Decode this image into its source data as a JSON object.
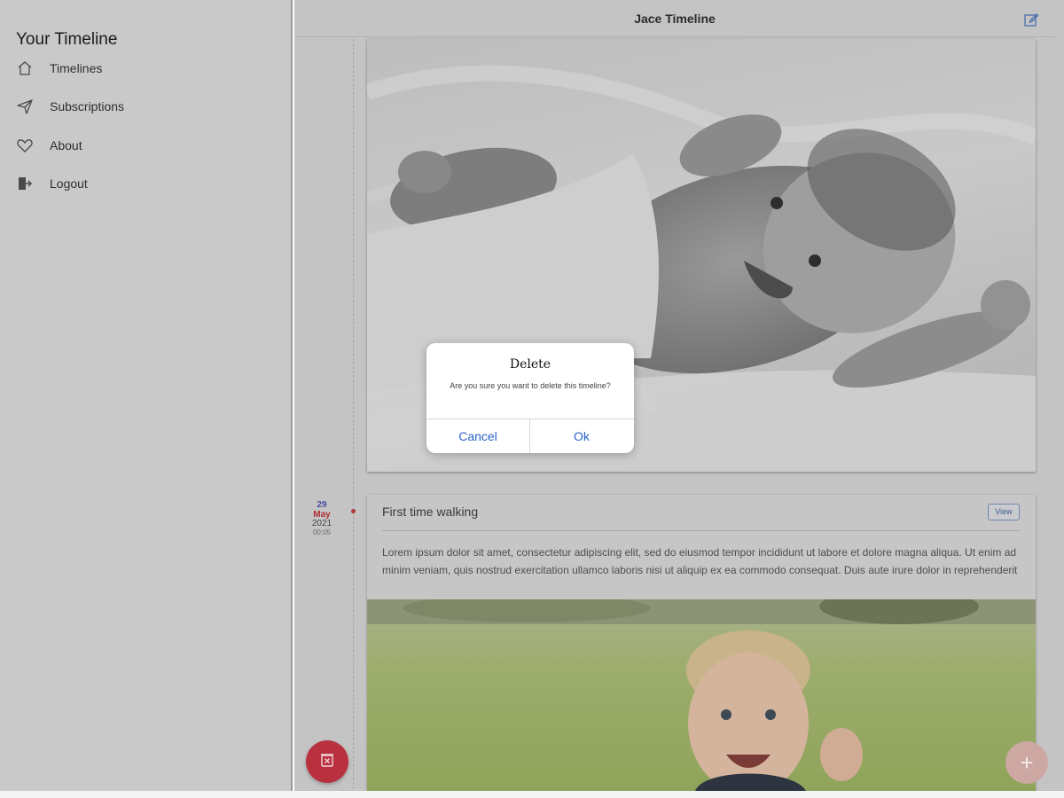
{
  "sidebar": {
    "title": "Your Timeline",
    "items": [
      {
        "label": "Timelines",
        "icon": "home-icon"
      },
      {
        "label": "Subscriptions",
        "icon": "send-icon"
      },
      {
        "label": "About",
        "icon": "heart-icon"
      },
      {
        "label": "Logout",
        "icon": "logout-icon"
      }
    ]
  },
  "header": {
    "title": "Jace Timeline",
    "edit_icon": "edit-icon"
  },
  "entries": [
    {
      "date": {
        "day": "29",
        "month": "May",
        "year": "2021",
        "time": "00:05"
      },
      "title": "First time walking",
      "view_label": "View",
      "body": "Lorem ipsum dolor sit amet, consectetur adipiscing elit, sed do eiusmod tempor incididunt ut labore et dolore magna aliqua. Ut enim ad minim veniam, quis nostrud exercitation ullamco laboris nisi ut aliquip ex ea commodo consequat. Duis aute irure dolor in reprehenderit in voluptate velit esse cillum dolore eu fugiat nulla pariatur."
    }
  ],
  "dialog": {
    "title": "Delete",
    "message": "Are you sure you want to delete this timeline?",
    "cancel_label": "Cancel",
    "ok_label": "Ok"
  },
  "fab": {
    "delete_icon": "trash-icon",
    "add_label": "+"
  },
  "colors": {
    "delete": "#b9303f",
    "add": "#cda8a3",
    "link": "#2a63c9",
    "overlay": "#c4c4c4"
  }
}
